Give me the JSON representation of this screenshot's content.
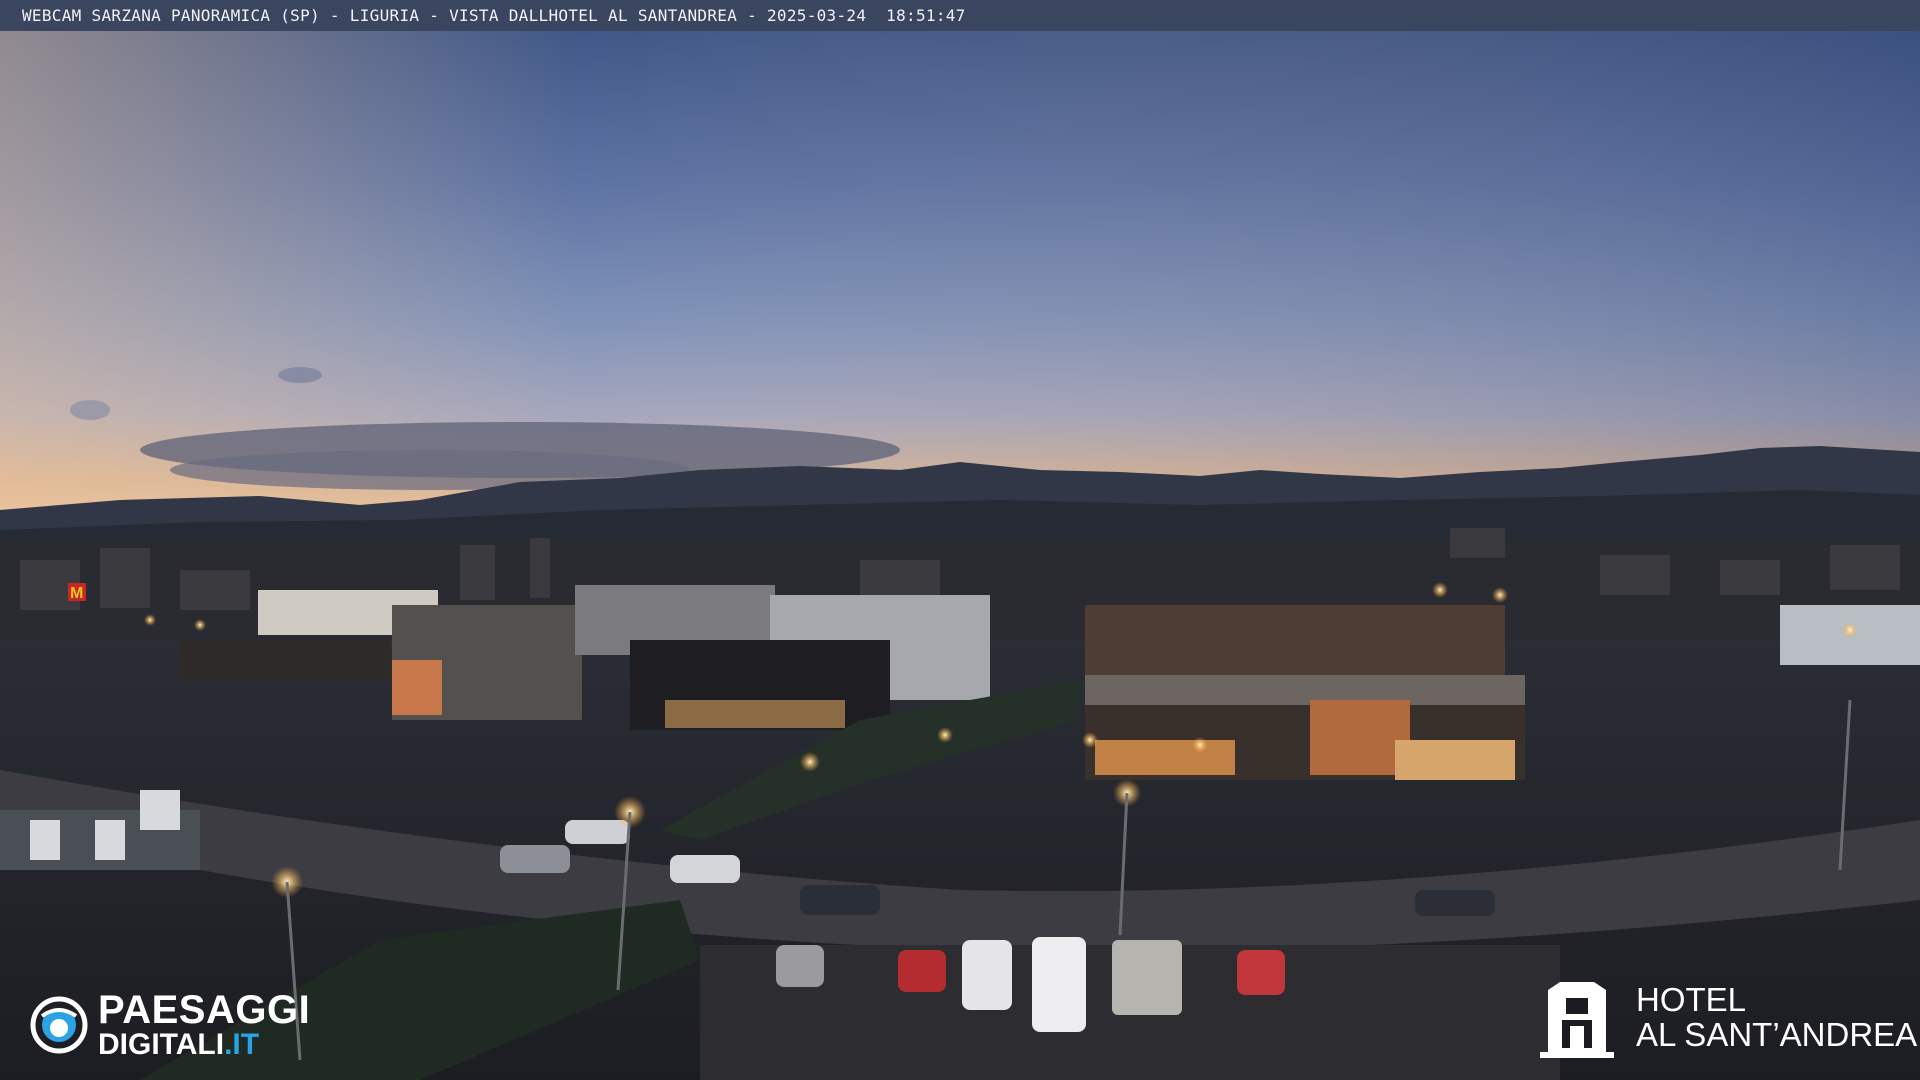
{
  "caption": {
    "text": "WEBCAM SARZANA PANORAMICA (SP) - LIGURIA - VISTA DALLHOTEL AL SANTANDREA - 2025-03-24  18:51:47"
  },
  "scene": {
    "description_icon": "panoramic-town-dusk-photo",
    "sky_top": "#3e5886",
    "sky_mid": "#7d8fb6",
    "horizon_glow": "#e0b48a",
    "mountains": "#2b3140"
  },
  "watermark_left": {
    "line1": "PAESAGGI",
    "line2_main": "DIGITALI",
    "line2_suffix": ".IT",
    "icon": "eye-icon",
    "accent": "#29a3e6"
  },
  "watermark_right": {
    "line1": "HOTEL",
    "line2": "AL SANT’ANDREA",
    "icon": "hotel-emblem-icon"
  }
}
